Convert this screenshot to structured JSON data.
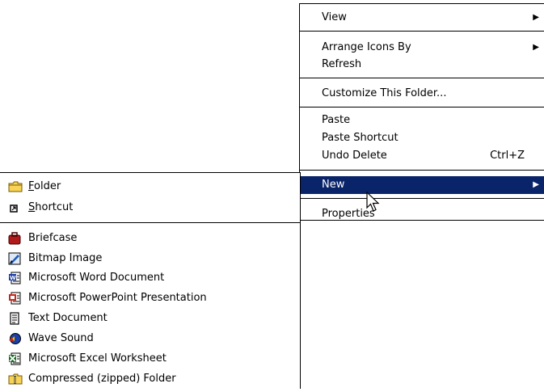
{
  "context_menu": {
    "items": [
      {
        "label": "View",
        "has_submenu": true
      },
      {
        "label": "Arrange Icons By",
        "has_submenu": true
      },
      {
        "label": "Refresh"
      },
      {
        "label": "Customize This Folder..."
      },
      {
        "label": "Paste"
      },
      {
        "label": "Paste Shortcut"
      },
      {
        "label": "Undo Delete",
        "shortcut": "Ctrl+Z"
      },
      {
        "label": "New",
        "has_submenu": true,
        "highlighted": true
      },
      {
        "label": "Properties"
      }
    ]
  },
  "new_submenu": {
    "items": [
      {
        "label_mnemonic": "F",
        "label_rest": "older",
        "icon": "folder-icon"
      },
      {
        "label_mnemonic": "S",
        "label_rest": "hortcut",
        "icon": "shortcut-icon"
      },
      {
        "label": "Briefcase",
        "icon": "briefcase-icon"
      },
      {
        "label": "Bitmap Image",
        "icon": "bitmap-icon"
      },
      {
        "label": "Microsoft Word Document",
        "icon": "word-document-icon"
      },
      {
        "label": "Microsoft PowerPoint Presentation",
        "icon": "powerpoint-icon"
      },
      {
        "label": "Text Document",
        "icon": "text-document-icon"
      },
      {
        "label": "Wave Sound",
        "icon": "wave-sound-icon"
      },
      {
        "label": "Microsoft Excel Worksheet",
        "icon": "excel-icon"
      },
      {
        "label": "Compressed (zipped) Folder",
        "icon": "zip-folder-icon"
      }
    ]
  },
  "colors": {
    "highlight": "#0a246a",
    "highlight_text": "#ffffff"
  }
}
